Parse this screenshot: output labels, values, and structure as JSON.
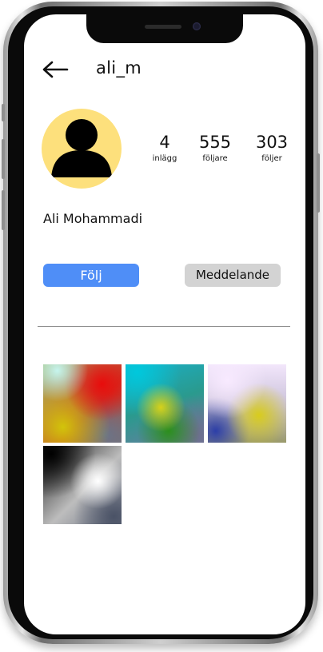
{
  "header": {
    "username": "ali_m"
  },
  "stats": [
    {
      "value": "4",
      "label": "inlägg"
    },
    {
      "value": "555",
      "label": "följare"
    },
    {
      "value": "303",
      "label": "följer"
    }
  ],
  "profile": {
    "full_name": "Ali Mohammadi",
    "avatar_color": "#fde07c"
  },
  "actions": {
    "follow_label": "Följ",
    "message_label": "Meddelande"
  },
  "colors": {
    "follow_button": "#4f8ef7",
    "message_button": "#d3d3d3"
  },
  "posts": [
    {
      "name": "post-1"
    },
    {
      "name": "post-2"
    },
    {
      "name": "post-3"
    },
    {
      "name": "post-4"
    }
  ]
}
